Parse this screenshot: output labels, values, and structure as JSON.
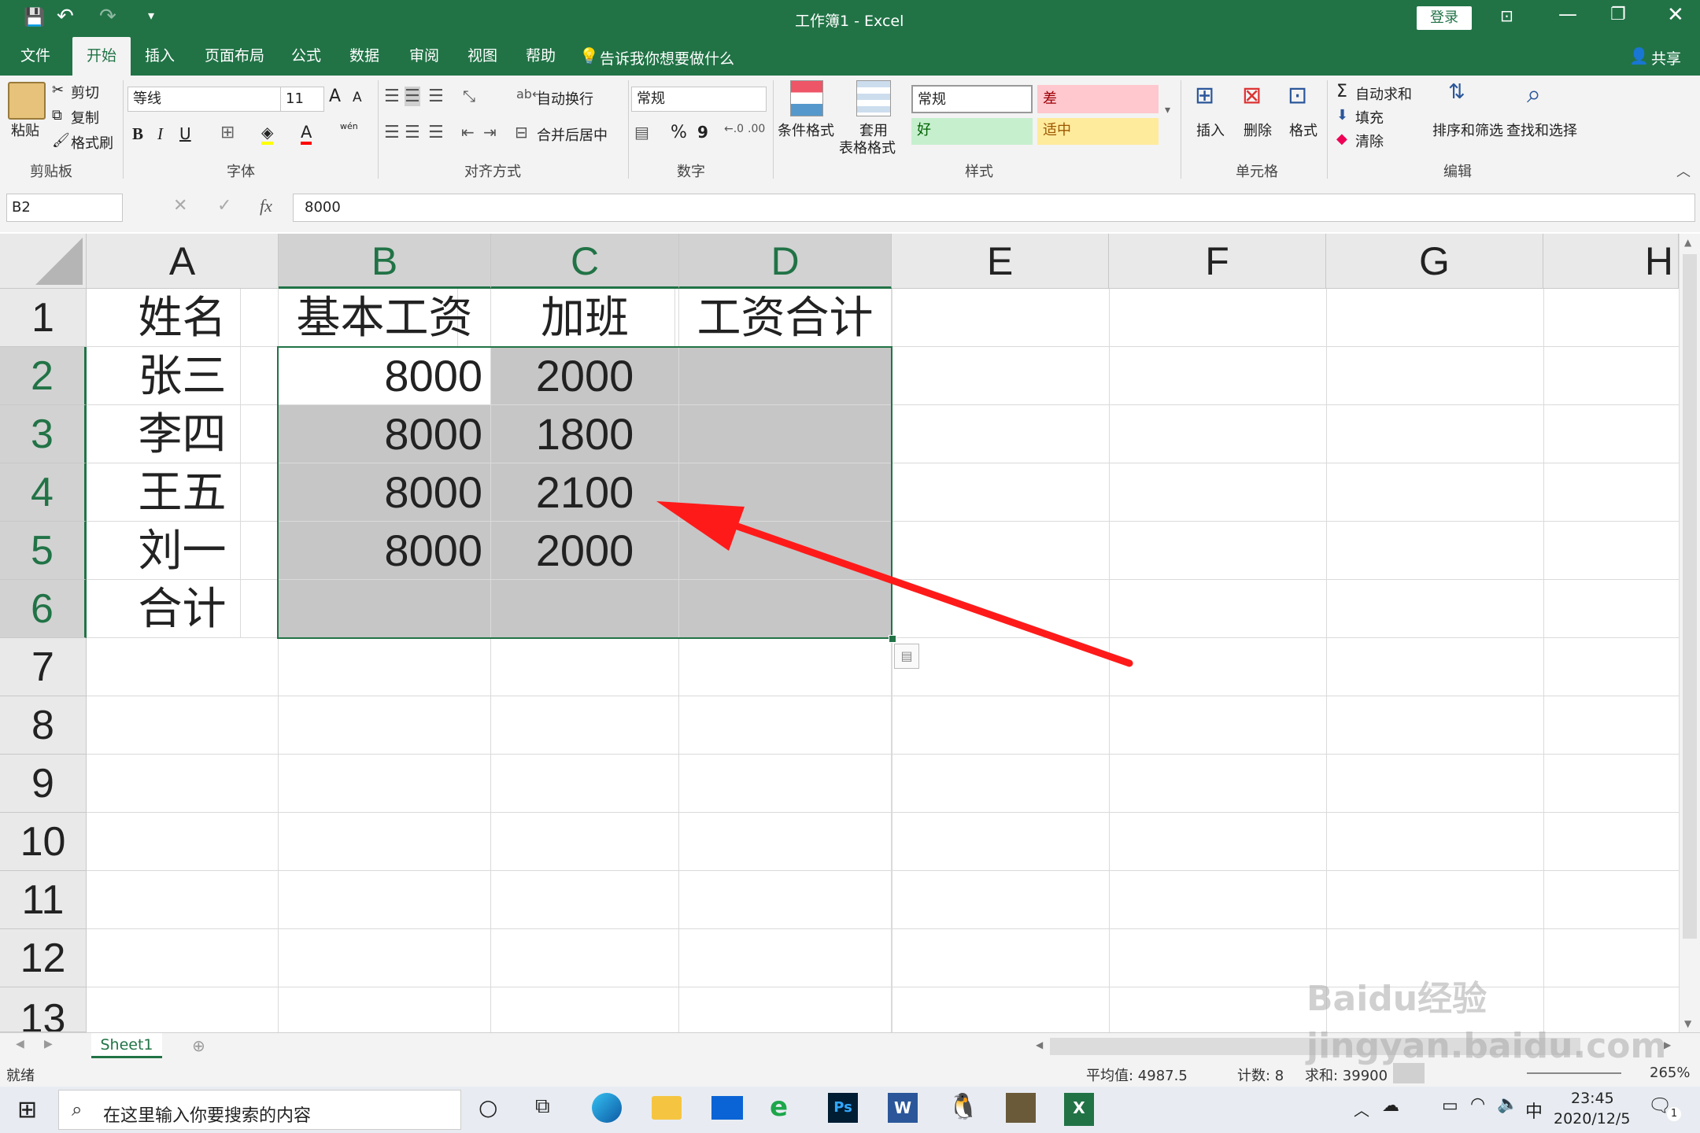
{
  "titlebar": {
    "title": "工作簿1  -  Excel",
    "login": "登录"
  },
  "tabs": [
    "文件",
    "开始",
    "插入",
    "页面布局",
    "公式",
    "数据",
    "审阅",
    "视图",
    "帮助"
  ],
  "tell_me": "告诉我你想要做什么",
  "share": "共享",
  "ribbon": {
    "clipboard": {
      "paste": "粘贴",
      "cut": "剪切",
      "copy": "复制",
      "format_painter": "格式刷",
      "group": "剪贴板"
    },
    "font": {
      "name": "等线",
      "size": "11",
      "grow": "A",
      "shrink": "A",
      "bold": "B",
      "italic": "I",
      "underline": "U",
      "wen": "wén",
      "group": "字体"
    },
    "align": {
      "wrap": "自动换行",
      "merge": "合并后居中",
      "group": "对齐方式"
    },
    "number": {
      "format": "常规",
      "percent": "%",
      "comma": "9",
      "group": "数字"
    },
    "styles": {
      "cond": "条件格式",
      "table1": "套用",
      "table2": "表格格式",
      "normal": "常规",
      "bad": "差",
      "good": "好",
      "neutral": "适中",
      "group": "样式"
    },
    "cells": {
      "insert": "插入",
      "delete": "删除",
      "format": "格式",
      "group": "单元格"
    },
    "editing": {
      "autosum": "自动求和",
      "fill": "填充",
      "clear": "清除",
      "sort": "排序和筛选",
      "find": "查找和选择",
      "group": "编辑"
    }
  },
  "formula": {
    "namebox": "B2",
    "fx": "fx",
    "value": "8000"
  },
  "columns": [
    "A",
    "B",
    "C",
    "D",
    "E",
    "F",
    "G",
    "H"
  ],
  "rows": [
    "1",
    "2",
    "3",
    "4",
    "5",
    "6",
    "7",
    "8",
    "9",
    "10",
    "11",
    "12",
    "13"
  ],
  "table": {
    "headers": [
      "姓名",
      "基本工资",
      "加班",
      "工资合计"
    ],
    "data": [
      [
        "张三",
        "8000",
        "2000",
        ""
      ],
      [
        "李四",
        "8000",
        "1800",
        ""
      ],
      [
        "王五",
        "8000",
        "2100",
        ""
      ],
      [
        "刘一",
        "8000",
        "2000",
        ""
      ],
      [
        "合计",
        "",
        "",
        ""
      ]
    ]
  },
  "sheet_tab": "Sheet1",
  "status": {
    "ready": "就绪",
    "average": "平均值: 4987.5",
    "count": "计数: 8",
    "sum": "求和: 39900",
    "zoom": "265%"
  },
  "taskbar": {
    "search": "在这里输入你要搜索的内容",
    "time": "23:45",
    "date": "2020/12/5",
    "ime": "中",
    "notif": "1"
  },
  "watermark": "Baidu经验 jingyan.baidu.com",
  "colors": {
    "excel_green": "#217346",
    "selection": "#c6c6c6",
    "arrow": "#ff1a1a"
  }
}
